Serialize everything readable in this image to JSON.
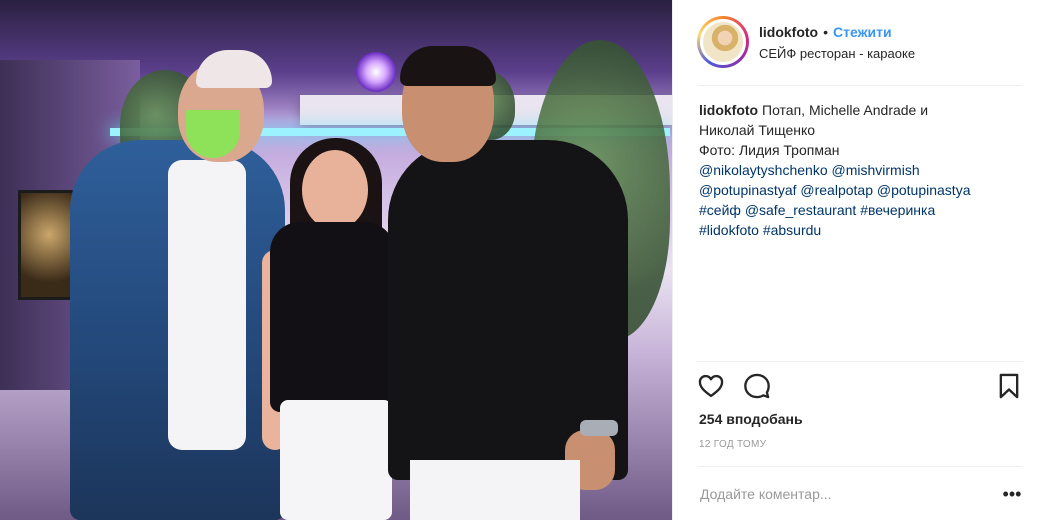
{
  "header": {
    "username": "lidokfoto",
    "separator": "•",
    "follow_label": "Стежити",
    "location": "СЕЙФ ресторан - караоке"
  },
  "caption": {
    "username": "lidokfoto",
    "text_line1": "Потап, Michelle Andrade и",
    "text_line2": "Николай Тищенко",
    "text_line3": "Фото: Лидия Тропман",
    "mentions_line1": [
      "@nikolaytyshchenko",
      "@mishvirmish"
    ],
    "mentions_line2": [
      "@potupinastyaf",
      "@realpotap",
      "@potupinastya"
    ],
    "tags_line3": [
      "#сейф",
      "@safe_restaurant",
      "#вечеринка"
    ],
    "tags_line4": [
      "#lidokfoto",
      "#absurdu"
    ]
  },
  "actions": {
    "like_icon": "heart-icon",
    "comment_icon": "comment-icon",
    "save_icon": "bookmark-icon"
  },
  "likes": "254 вподобань",
  "time_ago": "12 год тому",
  "comment": {
    "placeholder": "Додайте коментар...",
    "more_label": "•••"
  },
  "colors": {
    "link": "#003569",
    "follow": "#3897f0",
    "muted": "#999999",
    "text": "#262626"
  }
}
